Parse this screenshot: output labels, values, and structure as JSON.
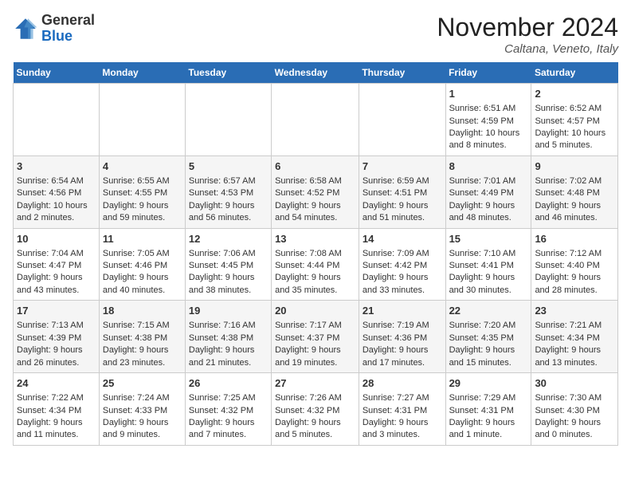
{
  "header": {
    "logo_general": "General",
    "logo_blue": "Blue",
    "month_title": "November 2024",
    "location": "Caltana, Veneto, Italy"
  },
  "days_of_week": [
    "Sunday",
    "Monday",
    "Tuesday",
    "Wednesday",
    "Thursday",
    "Friday",
    "Saturday"
  ],
  "weeks": [
    [
      {
        "day": "",
        "info": ""
      },
      {
        "day": "",
        "info": ""
      },
      {
        "day": "",
        "info": ""
      },
      {
        "day": "",
        "info": ""
      },
      {
        "day": "",
        "info": ""
      },
      {
        "day": "1",
        "info": "Sunrise: 6:51 AM\nSunset: 4:59 PM\nDaylight: 10 hours and 8 minutes."
      },
      {
        "day": "2",
        "info": "Sunrise: 6:52 AM\nSunset: 4:57 PM\nDaylight: 10 hours and 5 minutes."
      }
    ],
    [
      {
        "day": "3",
        "info": "Sunrise: 6:54 AM\nSunset: 4:56 PM\nDaylight: 10 hours and 2 minutes."
      },
      {
        "day": "4",
        "info": "Sunrise: 6:55 AM\nSunset: 4:55 PM\nDaylight: 9 hours and 59 minutes."
      },
      {
        "day": "5",
        "info": "Sunrise: 6:57 AM\nSunset: 4:53 PM\nDaylight: 9 hours and 56 minutes."
      },
      {
        "day": "6",
        "info": "Sunrise: 6:58 AM\nSunset: 4:52 PM\nDaylight: 9 hours and 54 minutes."
      },
      {
        "day": "7",
        "info": "Sunrise: 6:59 AM\nSunset: 4:51 PM\nDaylight: 9 hours and 51 minutes."
      },
      {
        "day": "8",
        "info": "Sunrise: 7:01 AM\nSunset: 4:49 PM\nDaylight: 9 hours and 48 minutes."
      },
      {
        "day": "9",
        "info": "Sunrise: 7:02 AM\nSunset: 4:48 PM\nDaylight: 9 hours and 46 minutes."
      }
    ],
    [
      {
        "day": "10",
        "info": "Sunrise: 7:04 AM\nSunset: 4:47 PM\nDaylight: 9 hours and 43 minutes."
      },
      {
        "day": "11",
        "info": "Sunrise: 7:05 AM\nSunset: 4:46 PM\nDaylight: 9 hours and 40 minutes."
      },
      {
        "day": "12",
        "info": "Sunrise: 7:06 AM\nSunset: 4:45 PM\nDaylight: 9 hours and 38 minutes."
      },
      {
        "day": "13",
        "info": "Sunrise: 7:08 AM\nSunset: 4:44 PM\nDaylight: 9 hours and 35 minutes."
      },
      {
        "day": "14",
        "info": "Sunrise: 7:09 AM\nSunset: 4:42 PM\nDaylight: 9 hours and 33 minutes."
      },
      {
        "day": "15",
        "info": "Sunrise: 7:10 AM\nSunset: 4:41 PM\nDaylight: 9 hours and 30 minutes."
      },
      {
        "day": "16",
        "info": "Sunrise: 7:12 AM\nSunset: 4:40 PM\nDaylight: 9 hours and 28 minutes."
      }
    ],
    [
      {
        "day": "17",
        "info": "Sunrise: 7:13 AM\nSunset: 4:39 PM\nDaylight: 9 hours and 26 minutes."
      },
      {
        "day": "18",
        "info": "Sunrise: 7:15 AM\nSunset: 4:38 PM\nDaylight: 9 hours and 23 minutes."
      },
      {
        "day": "19",
        "info": "Sunrise: 7:16 AM\nSunset: 4:38 PM\nDaylight: 9 hours and 21 minutes."
      },
      {
        "day": "20",
        "info": "Sunrise: 7:17 AM\nSunset: 4:37 PM\nDaylight: 9 hours and 19 minutes."
      },
      {
        "day": "21",
        "info": "Sunrise: 7:19 AM\nSunset: 4:36 PM\nDaylight: 9 hours and 17 minutes."
      },
      {
        "day": "22",
        "info": "Sunrise: 7:20 AM\nSunset: 4:35 PM\nDaylight: 9 hours and 15 minutes."
      },
      {
        "day": "23",
        "info": "Sunrise: 7:21 AM\nSunset: 4:34 PM\nDaylight: 9 hours and 13 minutes."
      }
    ],
    [
      {
        "day": "24",
        "info": "Sunrise: 7:22 AM\nSunset: 4:34 PM\nDaylight: 9 hours and 11 minutes."
      },
      {
        "day": "25",
        "info": "Sunrise: 7:24 AM\nSunset: 4:33 PM\nDaylight: 9 hours and 9 minutes."
      },
      {
        "day": "26",
        "info": "Sunrise: 7:25 AM\nSunset: 4:32 PM\nDaylight: 9 hours and 7 minutes."
      },
      {
        "day": "27",
        "info": "Sunrise: 7:26 AM\nSunset: 4:32 PM\nDaylight: 9 hours and 5 minutes."
      },
      {
        "day": "28",
        "info": "Sunrise: 7:27 AM\nSunset: 4:31 PM\nDaylight: 9 hours and 3 minutes."
      },
      {
        "day": "29",
        "info": "Sunrise: 7:29 AM\nSunset: 4:31 PM\nDaylight: 9 hours and 1 minute."
      },
      {
        "day": "30",
        "info": "Sunrise: 7:30 AM\nSunset: 4:30 PM\nDaylight: 9 hours and 0 minutes."
      }
    ]
  ]
}
